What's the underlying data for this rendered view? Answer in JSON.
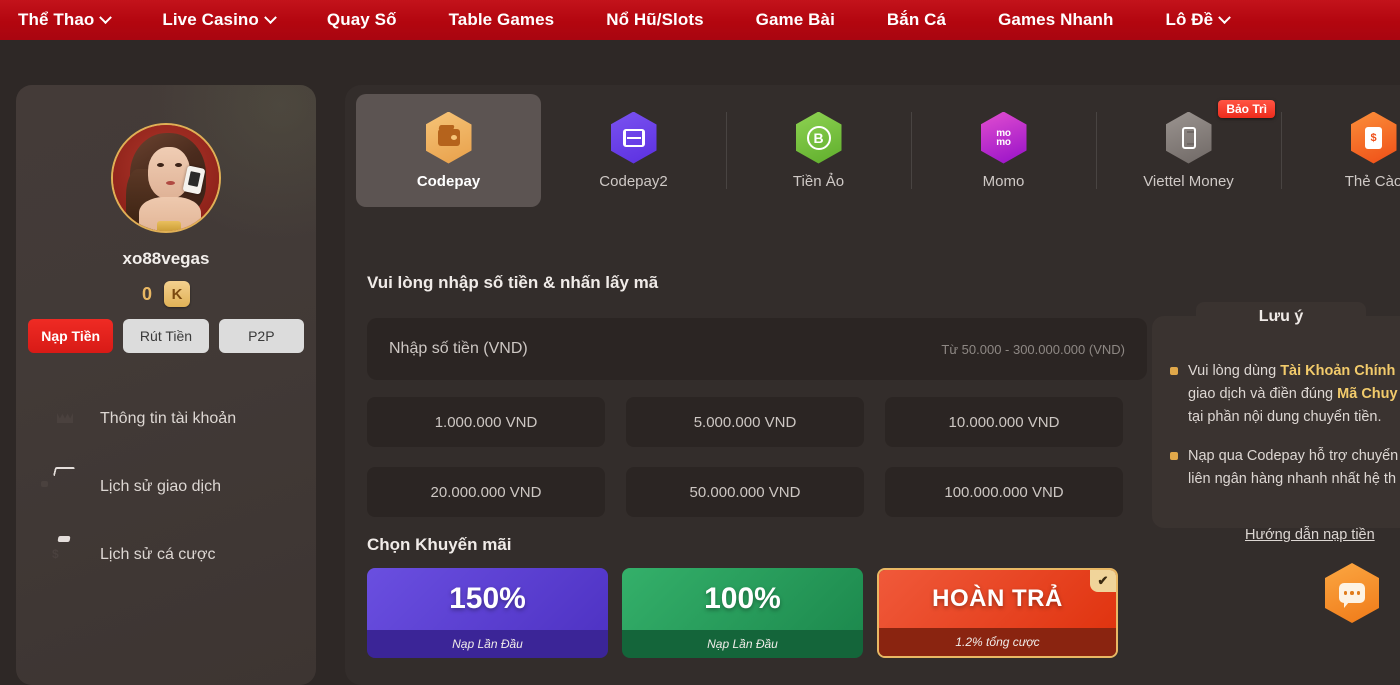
{
  "nav": {
    "items": [
      {
        "label": "Thể Thao",
        "caret": true
      },
      {
        "label": "Live Casino",
        "caret": true
      },
      {
        "label": "Quay Số",
        "caret": false
      },
      {
        "label": "Table Games",
        "caret": false
      },
      {
        "label": "Nổ Hũ/Slots",
        "caret": false
      },
      {
        "label": "Game Bài",
        "caret": false
      },
      {
        "label": "Bắn Cá",
        "caret": false
      },
      {
        "label": "Games Nhanh",
        "caret": false
      },
      {
        "label": "Lô Đề",
        "caret": true
      }
    ]
  },
  "sidebar": {
    "username": "xo88vegas",
    "balance": "0",
    "balance_unit": "K",
    "actions": [
      {
        "label": "Nạp Tiền",
        "active": true
      },
      {
        "label": "Rút Tiền",
        "active": false
      },
      {
        "label": "P2P",
        "active": false
      }
    ],
    "menu": [
      {
        "label": "Thông tin tài khoản",
        "icon": "crown-icon"
      },
      {
        "label": "Lịch sử giao dịch",
        "icon": "wallet-icon"
      },
      {
        "label": "Lịch sử cá cược",
        "icon": "money-bag-icon"
      }
    ]
  },
  "payment_tabs": [
    {
      "label": "Codepay",
      "icon": "wallet-icon",
      "active": true,
      "badge": ""
    },
    {
      "label": "Codepay2",
      "icon": "qr-scan-icon",
      "active": false,
      "badge": ""
    },
    {
      "label": "Tiền Ảo",
      "icon": "bitcoin-icon",
      "active": false,
      "badge": ""
    },
    {
      "label": "Momo",
      "icon": "momo-icon",
      "active": false,
      "badge": ""
    },
    {
      "label": "Viettel Money",
      "icon": "phone-icon",
      "active": false,
      "badge": "Bảo Trì"
    },
    {
      "label": "Thẻ Cào",
      "icon": "scratch-card-icon",
      "active": false,
      "badge": ""
    }
  ],
  "form": {
    "heading": "Vui lòng nhập số tiền & nhấn lấy mã",
    "amount_placeholder": "Nhập số tiền (VND)",
    "amount_value": "",
    "amount_hint": "Từ 50.000 - 300.000.000 (VND)",
    "quick_amounts": [
      "1.000.000 VND",
      "5.000.000 VND",
      "10.000.000 VND",
      "20.000.000 VND",
      "50.000.000 VND",
      "100.000.000 VND"
    ]
  },
  "promotions": {
    "heading": "Chọn Khuyến mãi",
    "items": [
      {
        "title": "150%",
        "subtitle": "Nạp Lần Đầu",
        "selected": false
      },
      {
        "title": "100%",
        "subtitle": "Nạp Lần Đầu",
        "selected": false
      },
      {
        "title": "HOÀN TRẢ",
        "subtitle": "1.2% tổng cược",
        "selected": true
      }
    ],
    "check_glyph": "✔"
  },
  "note": {
    "title": "Lưu ý",
    "line1a": "Vui lòng dùng ",
    "line1b": "Tài Khoản Chính C",
    "line2a": "giao dịch và điền đúng ",
    "line2b": "Mã Chuy",
    "line3": "tại phần nội dung chuyển tiền.",
    "line4": "Nạp qua Codepay hỗ trợ chuyển",
    "line5": "liên ngân hàng nhanh nhất hệ th",
    "link": "Hướng dẫn nạp tiền"
  },
  "colors": {
    "brand_red": "#b3060f",
    "accent_gold": "#e9b864",
    "page_bg": "#2e2826",
    "panel_bg": "#332d2b"
  }
}
